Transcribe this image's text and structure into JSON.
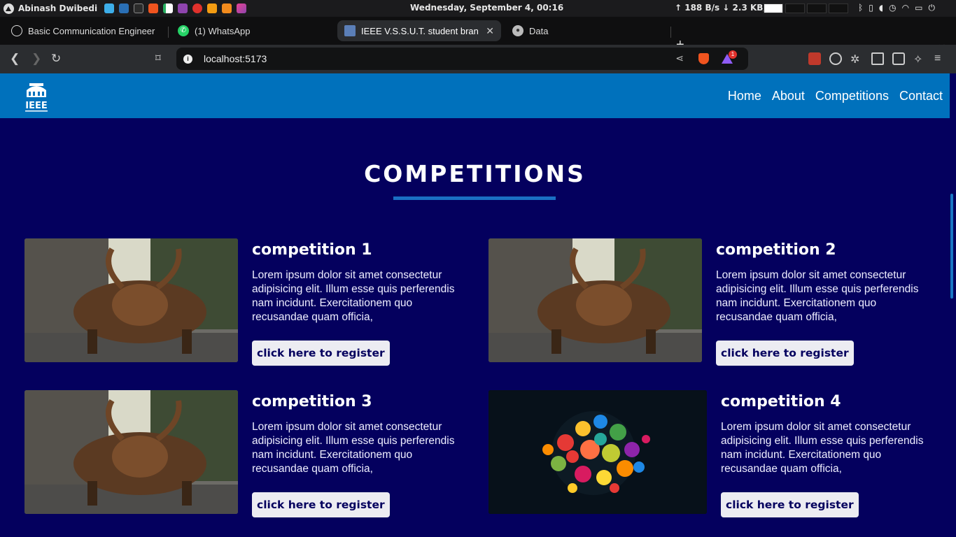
{
  "os_bar": {
    "user_name": "Abinash Dwibedi",
    "clock": "Wednesday, September   4, 00:16",
    "net_speed": "↑ 188 B/s ↓ 2.3 KB/s",
    "launcher_icons": [
      "files-icon",
      "vscode-icon",
      "terminal-icon",
      "brave-icon",
      "android-icon",
      "app-icon",
      "app-icon-2",
      "app-icon-3",
      "app-icon-4"
    ]
  },
  "tabs": [
    {
      "title": "Basic Communication Engineer",
      "icon": "openai-icon"
    },
    {
      "title": "(1) WhatsApp",
      "icon": "whatsapp-icon"
    },
    {
      "title": "IEEE V.S.S.U.T. student bran",
      "icon": "site-icon",
      "active": true
    },
    {
      "title": "Data",
      "icon": "globe-icon"
    }
  ],
  "address_bar": {
    "url": "localhost:5173",
    "rewards_badge": "1"
  },
  "site": {
    "logo_text": "IEEE",
    "nav": [
      "Home",
      "About",
      "Competitions",
      "Contact"
    ],
    "section_title": "COMPETITIONS",
    "competitions": [
      {
        "title": "competition 1",
        "description": "Lorem ipsum dolor sit amet consectetur adipisicing elit. Illum esse quis perferendis nam incidunt. Exercitationem quo recusandae quam officia,",
        "button": "click here to register",
        "image": "bull"
      },
      {
        "title": "competition 2",
        "description": "Lorem ipsum dolor sit amet consectetur adipisicing elit. Illum esse quis perferendis nam incidunt. Exercitationem quo recusandae quam officia,",
        "button": "click here to register",
        "image": "bull"
      },
      {
        "title": "competition 3",
        "description": "Lorem ipsum dolor sit amet consectetur adipisicing elit. Illum esse quis perferendis nam incidunt. Exercitationem quo recusandae quam officia,",
        "button": "click here to register",
        "image": "bull"
      },
      {
        "title": "competition 4",
        "description": "Lorem ipsum dolor sit amet consectetur adipisicing elit. Illum esse quis perferendis nam incidunt. Exercitationem quo recusandae quam officia,",
        "button": "click here to register",
        "image": "spheres"
      }
    ]
  },
  "colors": {
    "page_bg": "#04005e",
    "nav_bg": "#0071bc",
    "underline": "#1a6fc4",
    "button_bg": "#ececf2"
  }
}
